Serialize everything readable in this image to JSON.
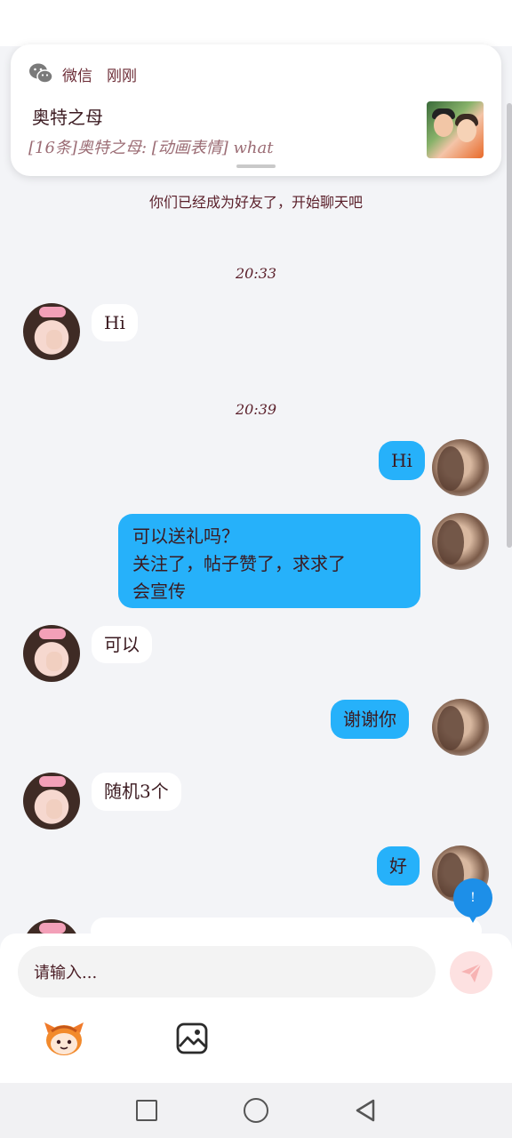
{
  "notification": {
    "app_name": "微信",
    "time": "刚刚",
    "title": "奥特之母",
    "body": "[16条]奥特之母: [动画表情] what",
    "icon": "wechat-icon"
  },
  "chat": {
    "system_message": "你们已经成为好友了，开始聊天吧",
    "timestamps": [
      "20:33",
      "20:39"
    ],
    "messages": [
      {
        "side": "in",
        "text": "Hi"
      },
      {
        "side": "out",
        "text": "Hi"
      },
      {
        "side": "out",
        "lines": [
          "可以送礼吗？",
          "关注了，帖子赞了，求求了",
          "会宣传"
        ]
      },
      {
        "side": "in",
        "text": "可以"
      },
      {
        "side": "out",
        "text": "谢谢你"
      },
      {
        "side": "in",
        "text": "随机3个"
      },
      {
        "side": "out",
        "text": "好"
      }
    ],
    "badge_text": "!"
  },
  "composer": {
    "placeholder": "请输入...",
    "send_icon": "send-icon",
    "emoji_icon": "emoji-sticker-icon",
    "image_icon": "image-icon"
  },
  "navbar": {
    "icons": [
      "recent-apps-icon",
      "home-icon",
      "back-icon"
    ]
  },
  "colors": {
    "outgoing_bubble": "#26b1fa",
    "incoming_bubble": "#ffffff",
    "background": "#f3f4f7",
    "text": "#5a1f2a"
  }
}
